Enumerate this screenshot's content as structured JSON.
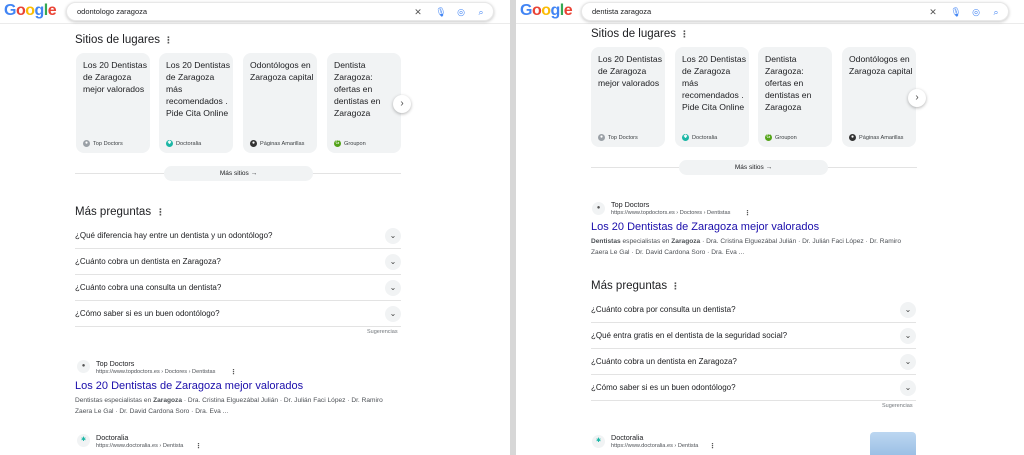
{
  "left": {
    "search": {
      "query": "odontologo zaragoza"
    },
    "sitios_heading": "Sitios de lugares",
    "cards": [
      {
        "title": "Los 20 Dentistas de Zaragoza mejor valorados",
        "source": "Top Doctors"
      },
      {
        "title": "Los 20 Dentistas de Zaragoza más recomendados . Pide Cita Online",
        "source": "Doctoralia"
      },
      {
        "title": "Odontólogos en Zaragoza capital",
        "source": "Páginas Amarillas"
      },
      {
        "title": "Dentista Zaragoza: ofertas en dentistas en Zaragoza",
        "source": "Groupon"
      }
    ],
    "mas_sitios": "Más sitios",
    "preguntas_heading": "Más preguntas",
    "questions": [
      "¿Qué diferencia hay entre un dentista y un odontólogo?",
      "¿Cuánto cobra un dentista en Zaragoza?",
      "¿Cuánto cobra una consulta un dentista?",
      "¿Cómo saber si es un buen odontólogo?"
    ],
    "sugerencias": "Sugerencias",
    "result1": {
      "site": "Top Doctors",
      "url": "https://www.topdoctors.es › Doctores › Dentistas",
      "title": "Los 20 Dentistas de Zaragoza mejor valorados",
      "snippet_a": "Dentistas especialistas en ",
      "snippet_b": "Zaragoza",
      "snippet_c": " · Dra. Cristina Elguezábal Julián · Dr. Julián Faci López · Dr. Ramiro Zaera Le Gal · Dr. David Cardona Soro · Dra. Eva ..."
    },
    "result2": {
      "site": "Doctoralia",
      "url": "https://www.doctoralia.es › Dentista"
    }
  },
  "right": {
    "search": {
      "query": "dentista zaragoza"
    },
    "sitios_heading": "Sitios de lugares",
    "cards": [
      {
        "title": "Los 20 Dentistas de Zaragoza mejor valorados",
        "source": "Top Doctors"
      },
      {
        "title": "Los 20 Dentistas de Zaragoza más recomendados . Pide Cita Online",
        "source": "Doctoralia"
      },
      {
        "title": "Dentista Zaragoza: ofertas en dentistas en Zaragoza",
        "source": "Groupon"
      },
      {
        "title": "Odontólogos en Zaragoza capital",
        "source": "Páginas Amarillas"
      }
    ],
    "mas_sitios": "Más sitios",
    "result1": {
      "site": "Top Doctors",
      "url": "https://www.topdoctors.es › Doctores › Dentistas",
      "title": "Los 20 Dentistas de Zaragoza mejor valorados",
      "snippet_a": "Dentistas",
      "snippet_b": " especialistas en ",
      "snippet_c": "Zaragoza",
      "snippet_d": " · Dra. Cristina Elguezábal Julián · Dr. Julián Faci López · Dr. Ramiro Zaera Le Gal · Dr. David Cardona Soro · Dra. Eva ..."
    },
    "preguntas_heading": "Más preguntas",
    "questions": [
      "¿Cuánto cobra por consulta un dentista?",
      "¿Qué entra gratis en el dentista de la seguridad social?",
      "¿Cuánto cobra un dentista en Zaragoza?",
      "¿Cómo saber si es un buen odontólogo?"
    ],
    "sugerencias": "Sugerencias",
    "result2": {
      "site": "Doctoralia",
      "url": "https://www.doctoralia.es › Dentista"
    }
  },
  "colors": {
    "link": "#1a0dab",
    "google_blue": "#4285f4",
    "google_red": "#ea4335",
    "google_yellow": "#fbbc05",
    "google_green": "#34a853"
  },
  "icons": [
    "clear-icon",
    "mic-icon",
    "lens-icon",
    "search-icon",
    "chevron-right-icon",
    "chevron-down-icon",
    "arrow-right-icon",
    "kebab-menu-icon"
  ]
}
